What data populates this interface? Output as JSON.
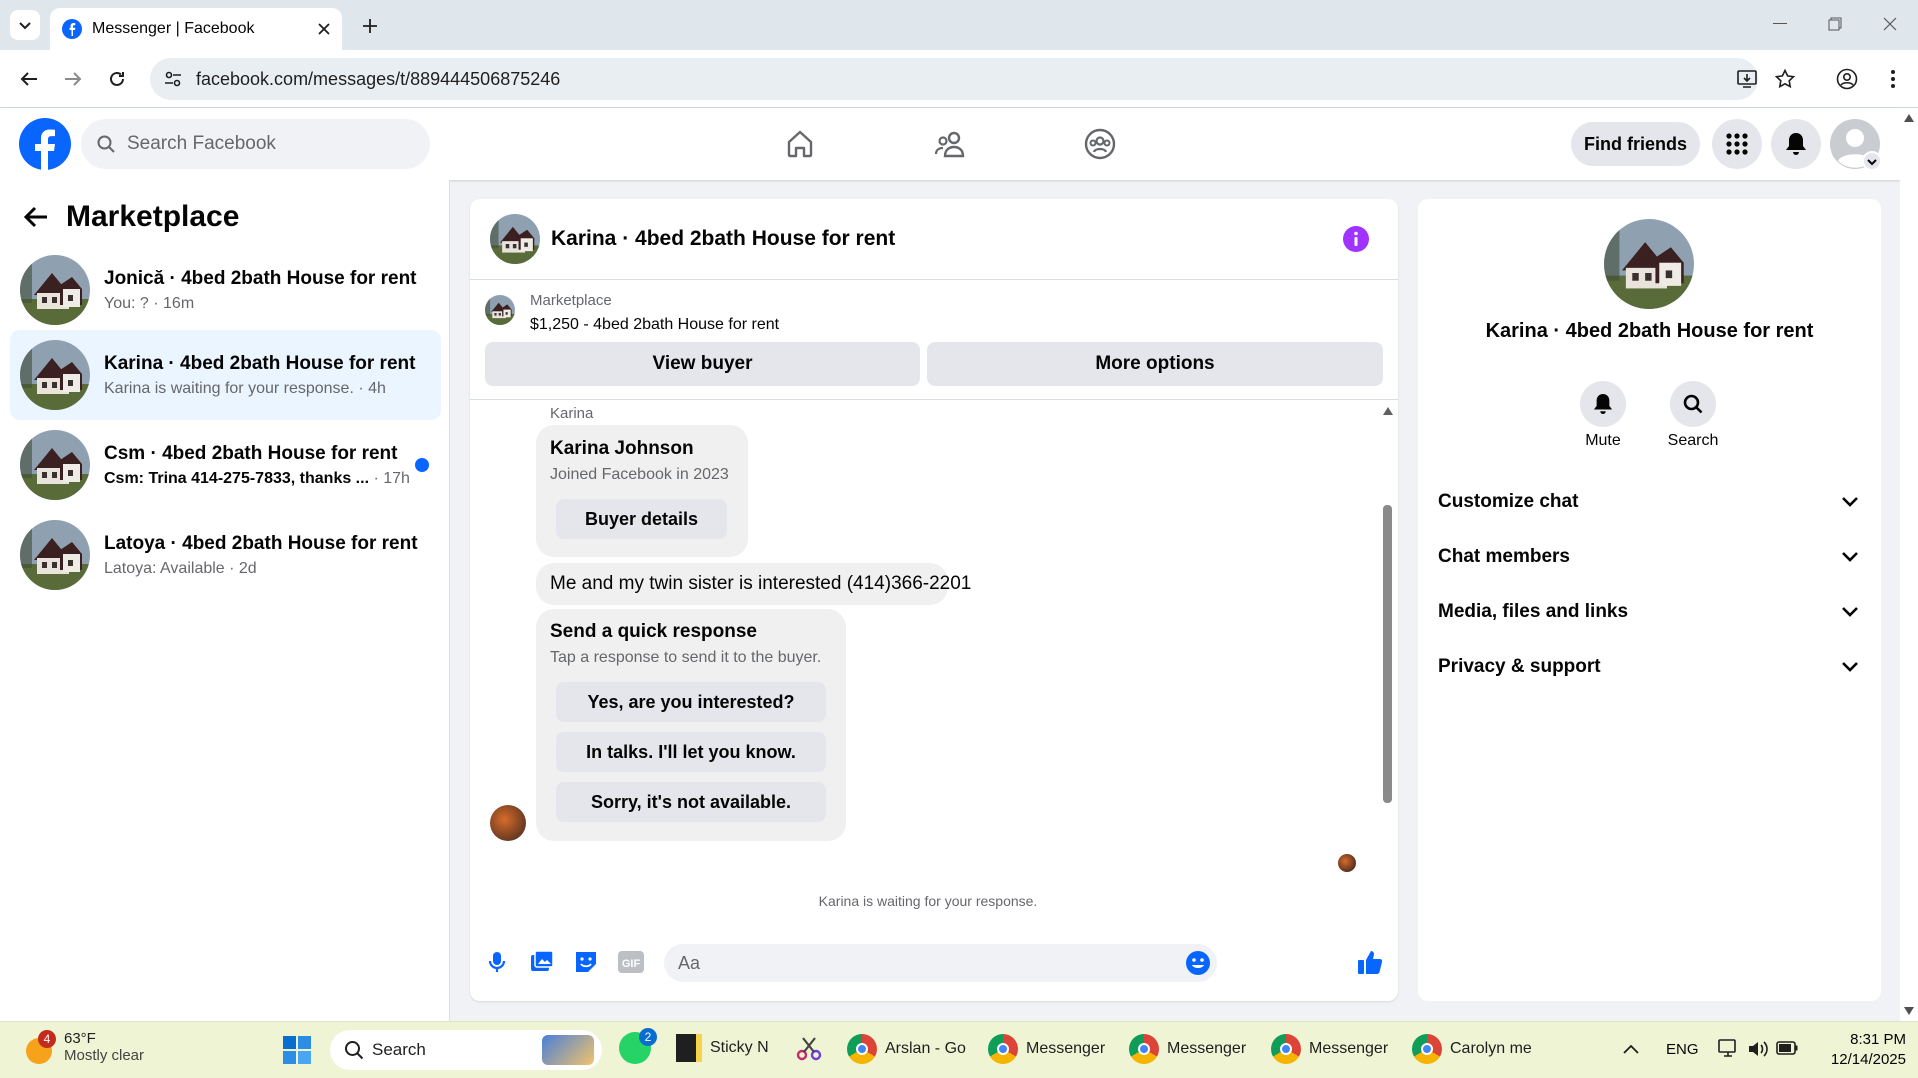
{
  "browser": {
    "tab_title": "Messenger | Facebook",
    "url": "facebook.com/messages/t/889444506875246"
  },
  "header": {
    "search_placeholder": "Search Facebook",
    "find_friends": "Find friends"
  },
  "sidebar": {
    "title": "Marketplace",
    "conversations": [
      {
        "title": "Jonică · 4bed 2bath House for rent",
        "preview": "You: ?",
        "time": "16m",
        "unread": false
      },
      {
        "title": "Karina · 4bed 2bath House for rent",
        "preview": "Karina is waiting for your response.",
        "time": "4h",
        "unread": false
      },
      {
        "title": "Csm · 4bed 2bath House for rent",
        "preview": "Csm: Trina 414-275-7833, thanks ...",
        "time": "17h",
        "unread": true
      },
      {
        "title": "Latoya · 4bed 2bath House for rent",
        "preview": "Latoya: Available",
        "time": "2d",
        "unread": false
      }
    ]
  },
  "chat": {
    "title": "Karina · 4bed 2bath House for rent",
    "listing_source": "Marketplace",
    "listing_detail": "$1,250 - 4bed 2bath House for rent",
    "view_buyer": "View buyer",
    "more_options": "More options",
    "sender_name": "Karina",
    "profile_card": {
      "name": "Karina Johnson",
      "joined": "Joined Facebook in 2023",
      "button": "Buyer details"
    },
    "message": "Me and my twin sister is interested (414)366-2201",
    "quick_response": {
      "title": "Send a quick response",
      "subtitle": "Tap a response to send it to the buyer.",
      "options": [
        "Yes, are you interested?",
        "In talks. I'll let you know.",
        "Sorry, it's not available."
      ]
    },
    "status": "Karina is waiting for your response.",
    "input_placeholder": "Aa"
  },
  "details": {
    "title": "Karina · 4bed 2bath House for rent",
    "mute": "Mute",
    "search": "Search",
    "sections": [
      "Customize chat",
      "Chat members",
      "Media, files and links",
      "Privacy & support"
    ]
  },
  "taskbar": {
    "weather_badge": "4",
    "temp": "63°F",
    "condition": "Mostly clear",
    "search": "Search",
    "whatsapp_badge": "2",
    "apps": [
      "Sticky N",
      "Arslan - Go",
      "Messenger",
      "Messenger",
      "Messenger",
      "Carolyn me"
    ],
    "lang": "ENG",
    "time": "8:31 PM",
    "date": "12/14/2025"
  },
  "colors": {
    "fb_blue": "#0866ff",
    "info_purple": "#a033ff",
    "unread_dot": "#0866ff",
    "active_row": "#ebf5ff"
  }
}
